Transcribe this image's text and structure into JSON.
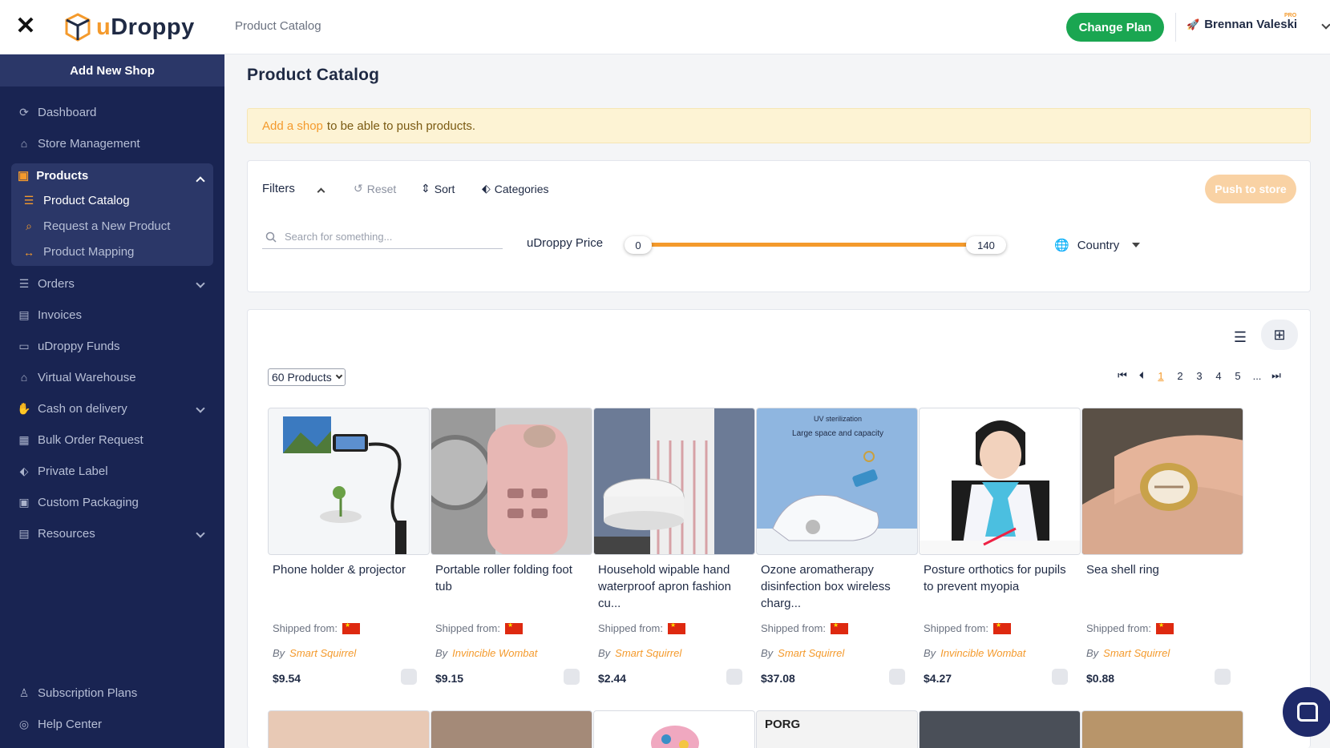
{
  "topbar": {
    "breadcrumb": "Product Catalog",
    "change_plan": "Change Plan",
    "user_name": "Brennan Valeski",
    "pro_badge": "PRO"
  },
  "logo": {
    "u": "u",
    "rest": "Droppy"
  },
  "sidebar": {
    "add_shop": "Add New Shop",
    "items": {
      "dashboard": "Dashboard",
      "store_management": "Store Management",
      "products": "Products",
      "orders": "Orders",
      "invoices": "Invoices",
      "funds": "uDroppy Funds",
      "warehouse": "Virtual Warehouse",
      "cod": "Cash on delivery",
      "bulk": "Bulk Order Request",
      "private_label": "Private Label",
      "packaging": "Custom Packaging",
      "resources": "Resources",
      "subscription": "Subscription Plans",
      "help": "Help Center"
    },
    "products_sub": {
      "catalog": "Product Catalog",
      "request": "Request a New Product",
      "mapping": "Product Mapping"
    }
  },
  "main": {
    "title": "Product Catalog",
    "alert_link": "Add a shop",
    "alert_text": "to be able to push products."
  },
  "filters": {
    "label": "Filters",
    "reset": "Reset",
    "sort": "Sort",
    "categories": "Categories",
    "push": "Push to store",
    "search_placeholder": "Search for something...",
    "price_label": "uDroppy Price",
    "price_min": "0",
    "price_max": "140",
    "country": "Country"
  },
  "grid": {
    "count": "60 Products",
    "pages": [
      "1",
      "2",
      "3",
      "4",
      "5",
      "..."
    ],
    "current_page": "1",
    "shipped_label": "Shipped from:",
    "by_label": "By",
    "products": [
      {
        "title": "Phone holder & projector",
        "supplier": "Smart Squirrel",
        "price": "$9.54"
      },
      {
        "title": "Portable roller folding foot tub",
        "supplier": "Invincible Wombat",
        "price": "$9.15"
      },
      {
        "title": "Household wipable hand waterproof apron fashion cu...",
        "supplier": "Smart Squirrel",
        "price": "$2.44"
      },
      {
        "title": "Ozone aromatherapy disinfection box wireless charg...",
        "supplier": "Smart Squirrel",
        "price": "$37.08"
      },
      {
        "title": "Posture orthotics for pupils to prevent myopia",
        "supplier": "Invincible Wombat",
        "price": "$4.27"
      },
      {
        "title": "Sea shell ring",
        "supplier": "Smart Squirrel",
        "price": "$0.88"
      }
    ],
    "image4_text_1": "UV sterilization",
    "image4_text_2": "Large space and capacity",
    "row2_text": "PORG"
  },
  "colors": {
    "accent": "#f49a2c",
    "sidebar": "#192452",
    "green": "#1aa651"
  }
}
